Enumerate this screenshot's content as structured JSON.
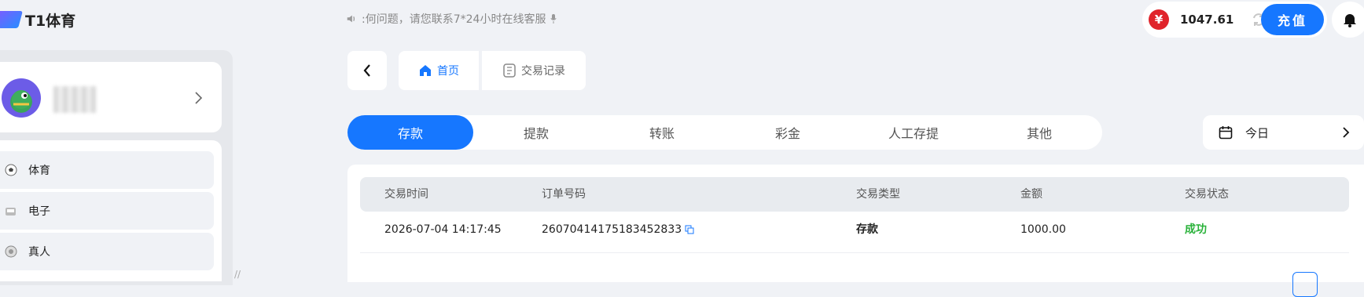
{
  "app": {
    "title": "T1体育"
  },
  "notice": {
    "text": ":何问题，请您联系7*24小时在线客服"
  },
  "wallet": {
    "currency_symbol": "¥",
    "balance": "1047.61",
    "recharge_label": "充值"
  },
  "sidebar": {
    "items": [
      {
        "label": "体育",
        "icon": "soccer-ball-icon"
      },
      {
        "label": "电子",
        "icon": "slot-machine-icon"
      },
      {
        "label": "真人",
        "icon": "casino-chip-icon"
      }
    ]
  },
  "breadcrumb": {
    "home": "首页",
    "records": "交易记录"
  },
  "tabs": [
    "存款",
    "提款",
    "转账",
    "彩金",
    "人工存提",
    "其他"
  ],
  "active_tab": "存款",
  "date_filter": {
    "label": "今日"
  },
  "table": {
    "columns": [
      "交易时间",
      "订单号码",
      "交易类型",
      "金额",
      "交易状态"
    ],
    "rows": [
      {
        "time": "2026-07-04 14:17:45",
        "order": "26070414175183452833",
        "type": "存款",
        "amount": "1000.00",
        "status": "成功"
      }
    ]
  },
  "colors": {
    "accent": "#1677ff",
    "success": "#29b23a",
    "coin": "#e0242b"
  }
}
